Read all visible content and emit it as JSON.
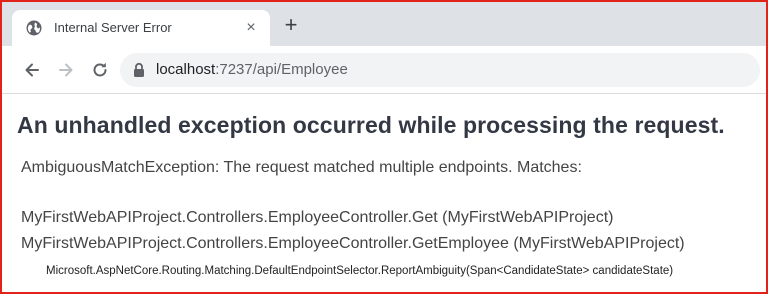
{
  "browser": {
    "tab": {
      "title": "Internal Server Error",
      "favicon": "globe-icon",
      "close_symbol": "×"
    },
    "new_tab_symbol": "+",
    "address_bar": {
      "host": "localhost",
      "path": ":7237/api/Employee",
      "secure_icon": "lock-icon"
    },
    "nav_icons": [
      "back-arrow-icon",
      "forward-arrow-icon",
      "reload-icon"
    ]
  },
  "page": {
    "heading": "An unhandled exception occurred while processing the request.",
    "exception_message": "AmbiguousMatchException: The request matched multiple endpoints. Matches:",
    "matches": [
      "MyFirstWebAPIProject.Controllers.EmployeeController.Get (MyFirstWebAPIProject)",
      "MyFirstWebAPIProject.Controllers.EmployeeController.GetEmployee (MyFirstWebAPIProject)"
    ],
    "stack_frame": "Microsoft.AspNetCore.Routing.Matching.DefaultEndpointSelector.ReportAmbiguity(Span<CandidateState> candidateState)"
  },
  "colors": {
    "frame_border": "#e2231a",
    "tabstrip": "#dee1e6",
    "omnibox": "#f1f3f4",
    "heading": "#333944",
    "body_text": "#444444"
  }
}
